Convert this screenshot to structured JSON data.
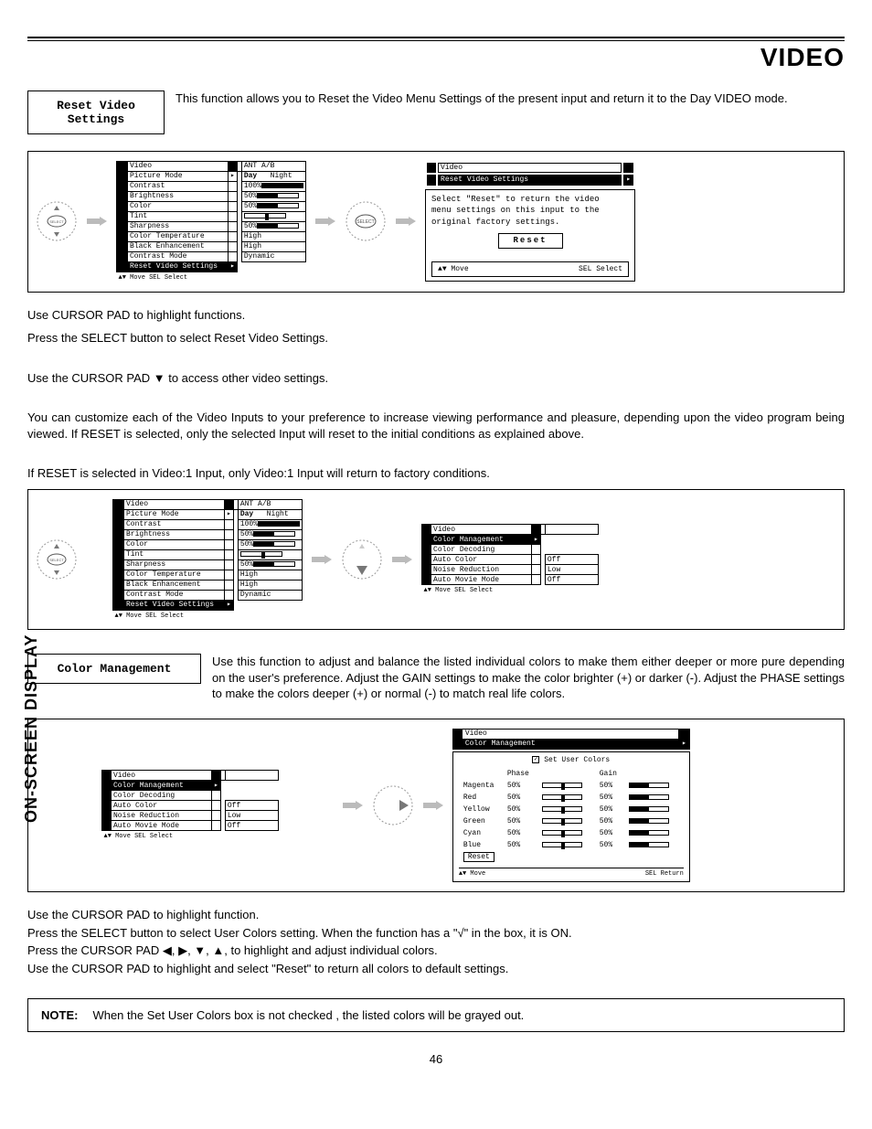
{
  "page": {
    "title": "VIDEO",
    "sidebar": "ON-SCREEN DISPLAY",
    "number": "46"
  },
  "section1": {
    "heading": "Reset Video\nSettings",
    "intro": "This function allows you to Reset the Video Menu Settings of the present input and return it to the Day VIDEO mode.",
    "body": [
      "Use CURSOR PAD to highlight functions.",
      "Press the SELECT button to select Reset Video Settings.",
      "",
      "Use the CURSOR PAD ▼ to access other video settings.",
      "",
      "You can customize each of the Video Inputs to your preference to increase viewing performance and pleasure, depending upon the video program being viewed. If RESET is selected, only the selected Input will reset to the initial conditions as explained above.",
      "",
      "If RESET is selected in Video:1 Input, only Video:1 Input will return to factory conditions."
    ]
  },
  "osd_video": {
    "title": "Video",
    "input": "ANT A/B",
    "rows": [
      {
        "label": "Picture Mode",
        "value": "Day",
        "value2": "Night",
        "type": "text2"
      },
      {
        "label": "Contrast",
        "value": "100%",
        "type": "bar",
        "pct": 100
      },
      {
        "label": "Brightness",
        "value": "50%",
        "type": "bar",
        "pct": 50
      },
      {
        "label": "Color",
        "value": "50%",
        "type": "bar",
        "pct": 50
      },
      {
        "label": "Tint",
        "value": "",
        "type": "slider",
        "pos": 50
      },
      {
        "label": "Sharpness",
        "value": "50%",
        "type": "bar",
        "pct": 50
      },
      {
        "label": "Color Temperature",
        "value": "High",
        "type": "text"
      },
      {
        "label": "Black Enhancement",
        "value": "High",
        "type": "text"
      },
      {
        "label": "Contrast Mode",
        "value": "Dynamic",
        "type": "text"
      },
      {
        "label": "Reset Video Settings",
        "value": "",
        "type": "hl"
      }
    ],
    "footer": "▲▼ Move  SEL Select"
  },
  "osd_reset": {
    "title": "Video",
    "sub": "Reset Video Settings",
    "msg1": "Select \"Reset\" to return the video",
    "msg2": "menu settings on this input to the",
    "msg3": "original factory settings.",
    "button": "Reset",
    "foot_left": "▲▼ Move",
    "foot_right": "SEL Select"
  },
  "osd_video2": {
    "title": "Video",
    "rows": [
      {
        "label": "Color Management",
        "hl": true,
        "arrow": true
      },
      {
        "label": "Color Decoding"
      },
      {
        "label": "Auto Color",
        "value": "Off",
        "box": true
      },
      {
        "label": "Noise Reduction",
        "value": "Low",
        "box": true
      },
      {
        "label": "Auto Movie Mode",
        "value": "Off",
        "box": true
      }
    ],
    "footer": "▲▼ Move  SEL Select"
  },
  "section2": {
    "heading": "Color Management",
    "intro": "Use this function to adjust and balance the listed individual colors to make them either deeper or more pure depending on the user's preference.  Adjust the GAIN settings to make the color brighter (+) or darker (-).  Adjust the PHASE settings to make the colors deeper (+) or normal (-) to match real life colors.",
    "body": [
      "Use the CURSOR PAD to highlight function.",
      "Press the SELECT button to select User Colors setting.  When the function has a \"√\" in the box, it is ON.",
      "Press  the CURSOR PAD ◀, ▶, ▼, ▲, to highlight and adjust individual colors.",
      "Use  the CURSOR PAD to highlight and select \"Reset\" to return all colors to default settings."
    ]
  },
  "osd_cm": {
    "title": "Video",
    "sub": "Color Management",
    "check_label": "Set User Colors",
    "col1": "Phase",
    "col2": "Gain",
    "rows": [
      {
        "name": "Magenta",
        "phase": "50%",
        "gain": "50%"
      },
      {
        "name": "Red",
        "phase": "50%",
        "gain": "50%"
      },
      {
        "name": "Yellow",
        "phase": "50%",
        "gain": "50%"
      },
      {
        "name": "Green",
        "phase": "50%",
        "gain": "50%"
      },
      {
        "name": "Cyan",
        "phase": "50%",
        "gain": "50%"
      },
      {
        "name": "Blue",
        "phase": "50%",
        "gain": "50%"
      }
    ],
    "reset": "Reset",
    "foot_left": "▲▼ Move",
    "foot_right": "SEL Return"
  },
  "note": {
    "label": "NOTE:",
    "text": "When the Set User Colors box is not checked , the listed colors will be grayed out."
  }
}
